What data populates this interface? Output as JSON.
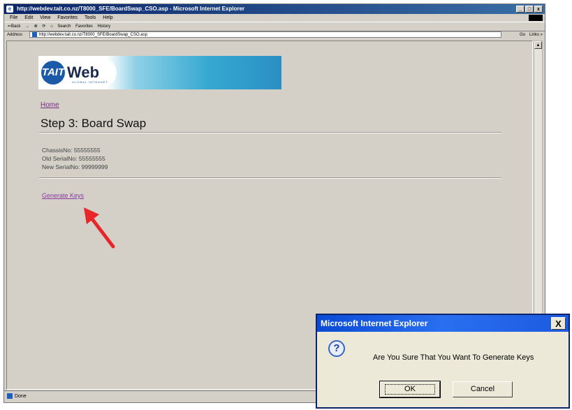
{
  "browser": {
    "title": "http://webdev.tait.co.nz/T8000_SFE/BoardSwap_CSO.asp - Microsoft Internet Explorer",
    "menu": [
      "File",
      "Edit",
      "View",
      "Favorites",
      "Tools",
      "Help"
    ],
    "toolbar": [
      "⇐Back",
      "→",
      "⊗",
      "⟳",
      "⌂",
      "Search",
      "Favorites",
      "History"
    ],
    "address_label": "Address",
    "address": "http://webdev.tait.co.nz/T8000_SFE/BoardSwap_CSO.asp",
    "go_label": "Go",
    "links_label": "Links »",
    "status": "Done"
  },
  "banner": {
    "logo_mark": "TAIT",
    "logo_text": "Web",
    "logo_sub": "GLOBAL INTRANET"
  },
  "page": {
    "home_link": "Home",
    "title": "Step 3: Board Swap",
    "chassis": "ChassisNo: 55555555",
    "old_serial": "Old SerialNo: 55555555",
    "new_serial": "New SerialNo: 99999999",
    "generate_link": "Generate Keys"
  },
  "dialog": {
    "title": "Microsoft Internet Explorer",
    "close": "X",
    "icon": "?",
    "message": "Are You Sure That You Want To Generate Keys",
    "ok": "OK",
    "cancel": "Cancel"
  },
  "colors": {
    "annotation_arrow": "#e8262a",
    "link_visited": "#8a3aa0",
    "dialog_title": "#0a4ad5"
  }
}
